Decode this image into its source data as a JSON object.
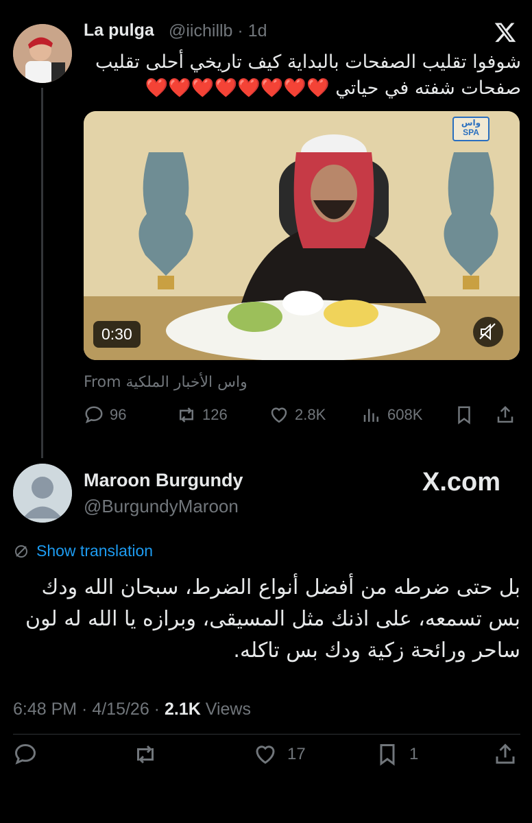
{
  "tweet1": {
    "name": "La pulga",
    "handle": "@iichillb",
    "time": "· 1d",
    "text": "شوفوا تقليب الصفحات بالبداية كيف تاريخي أحلى تقليب صفحات شفته في حياتي",
    "hearts": "❤️❤️❤️❤️❤️❤️❤️❤️",
    "video_duration": "0:30",
    "from_label": "From واس الأخبار الملكية",
    "spa_logo": "واس SPA",
    "replies": "96",
    "reposts": "126",
    "likes": "2.8K",
    "views": "608K"
  },
  "tweet2": {
    "name": "Maroon Burgundy",
    "handle": "@BurgundyMaroon",
    "watermark": "X.com",
    "show_translation": "Show translation",
    "text": "بل حتى ضرطه من أفضل أنواع الضرط، سبحان الله ودك بس تسمعه، على اذنك مثل المسيقى، وبرازه يا الله له لون ساحر ورائحة زكية ودك بس تاكله.",
    "time": "6:48 PM · 4/15/26 ·",
    "views_count": "2.1K",
    "views_label": "Views",
    "likes": "17",
    "bookmarks": "1"
  },
  "colors": {
    "background": "#000000",
    "text": "#e7e9ea",
    "muted": "#71767b",
    "link": "#1d9bf0",
    "heart": "#e0244a"
  },
  "icons": [
    "x-logo-icon",
    "reply-icon",
    "repost-icon",
    "like-icon",
    "views-icon",
    "bookmark-icon",
    "share-icon",
    "translate-icon",
    "mute-icon"
  ]
}
